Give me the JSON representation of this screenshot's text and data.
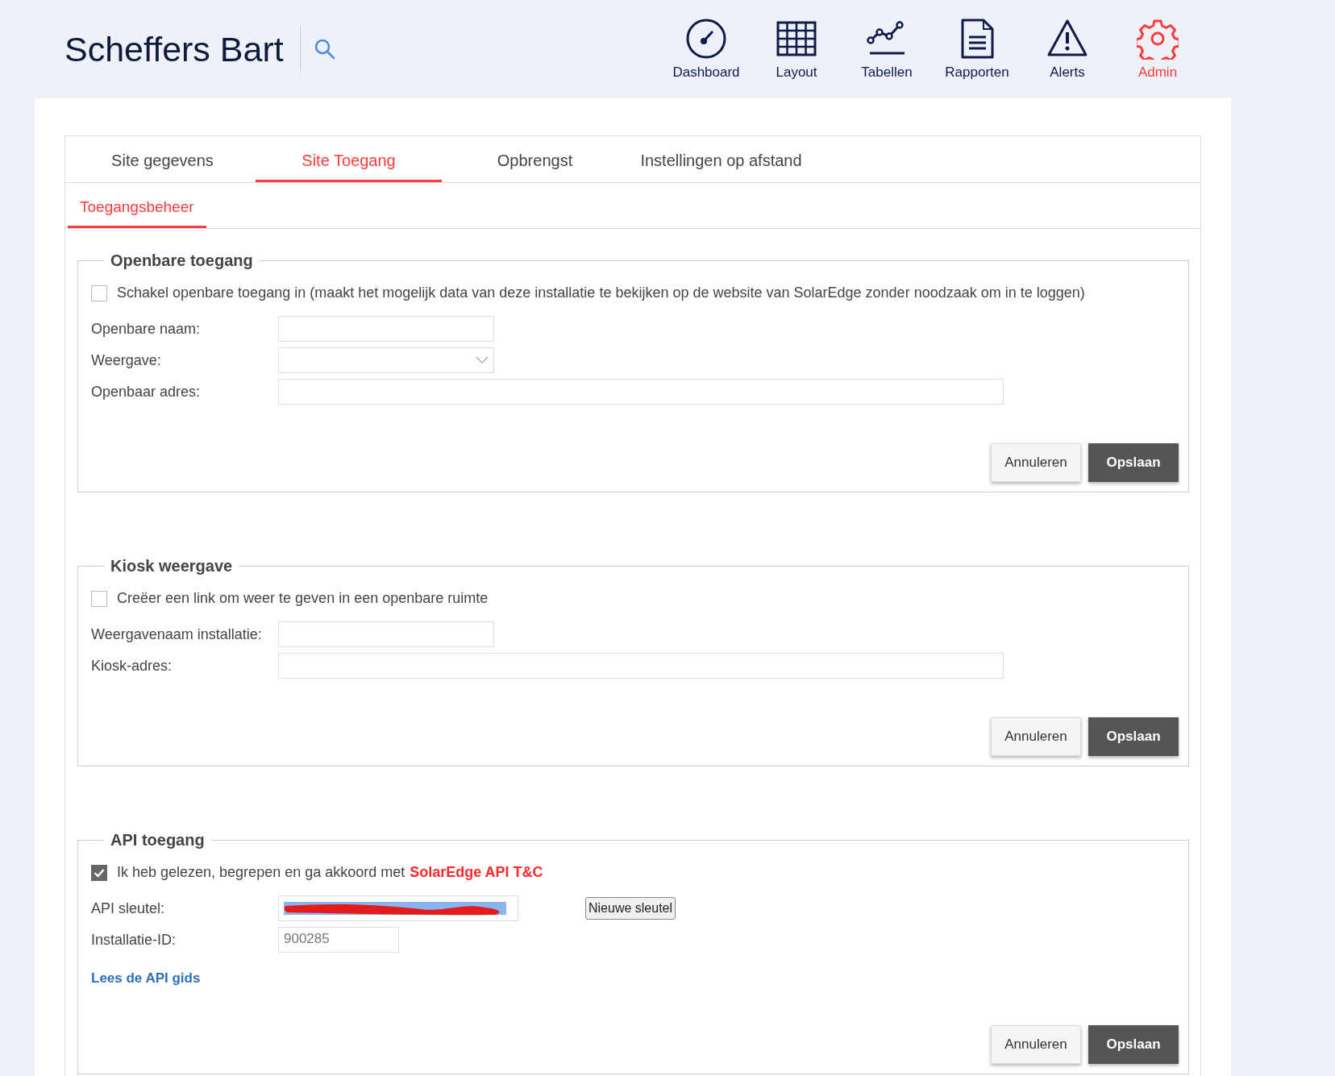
{
  "header": {
    "title": "Scheffers Bart"
  },
  "nav": [
    {
      "label": "Dashboard",
      "selected": false
    },
    {
      "label": "Layout",
      "selected": false
    },
    {
      "label": "Tabellen",
      "selected": false
    },
    {
      "label": "Rapporten",
      "selected": false
    },
    {
      "label": "Alerts",
      "selected": false
    },
    {
      "label": "Admin",
      "selected": true
    }
  ],
  "tabs": [
    {
      "label": "Site gegevens",
      "selected": false
    },
    {
      "label": "Site Toegang",
      "selected": true
    },
    {
      "label": "Opbrengst",
      "selected": false
    },
    {
      "label": "Instellingen op afstand",
      "selected": false
    }
  ],
  "subtabs": [
    {
      "label": "Toegangsbeheer",
      "selected": true
    }
  ],
  "sections": [
    {
      "title": "Openbare toegang",
      "checkbox": {
        "label": "Schakel openbare toegang in (maakt het mogelijk data van deze installatie te bekijken op de website van SolarEdge zonder noodzaak om in te loggen)",
        "checked": false
      },
      "fields": [
        {
          "label": "Openbare naam:",
          "kind": "short"
        },
        {
          "label": "Weergave:",
          "kind": "dropdown"
        },
        {
          "label": "Openbaar adres:",
          "kind": "long"
        }
      ],
      "buttons": [
        "Annuleren",
        "Opslaan"
      ]
    },
    {
      "title": "Kiosk weergave",
      "checkbox": {
        "label": "Creëer een link om weer te geven in een openbare ruimte",
        "checked": false
      },
      "fields": [
        {
          "label": "Weergavenaam installatie:",
          "kind": "short"
        },
        {
          "label": "Kiosk-adres:",
          "kind": "long"
        }
      ],
      "buttons": [
        "Annuleren",
        "Opslaan"
      ]
    },
    {
      "title": "API toegang",
      "checkbox": {
        "label": "Ik heb gelezen, begrepen en ga akkoord met",
        "link": "SolarEdge API T&C",
        "checked": true
      },
      "fields": [
        {
          "label": "API sleutel:",
          "kind": "secret",
          "action": "Nieuwe sleutel"
        },
        {
          "label": "Installatie-ID:",
          "kind": "readonly",
          "value": "900285"
        }
      ],
      "link": "Lees de API gids",
      "buttons": [
        "Annuleren",
        "Opslaan"
      ]
    }
  ]
}
